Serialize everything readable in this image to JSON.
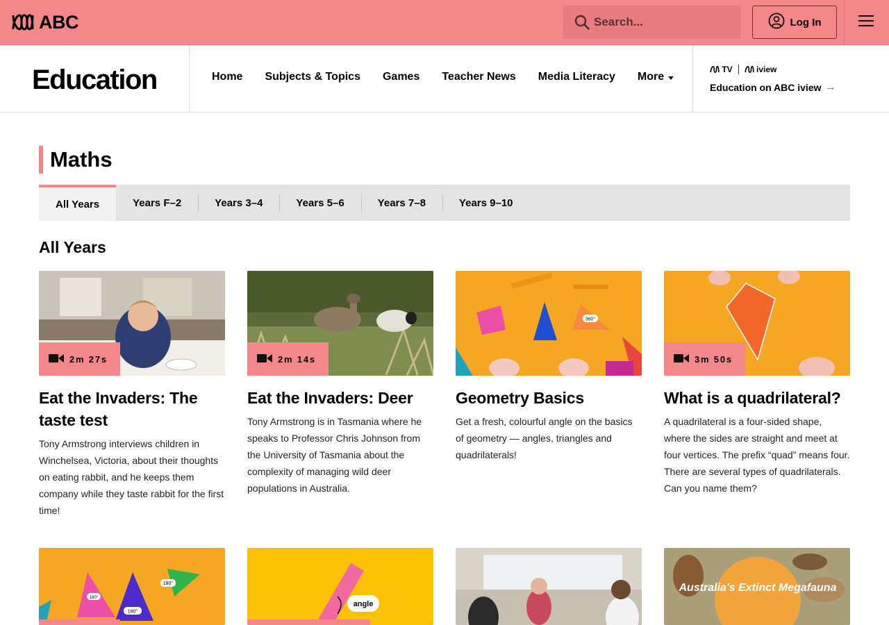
{
  "header": {
    "logo_text": "ABC",
    "search_placeholder": "Search...",
    "login_label": "Log In"
  },
  "nav": {
    "brand": "Education",
    "links": [
      "Home",
      "Subjects & Topics",
      "Games",
      "Teacher News",
      "Media Literacy"
    ],
    "more_label": "More",
    "iview_tv": "TV",
    "iview_brand": "iview",
    "iview_link": "Education on ABC iview",
    "iview_arrow": "→"
  },
  "page": {
    "heading": "Maths",
    "section_title": "All Years",
    "tabs": [
      "All Years",
      "Years F–2",
      "Years 3–4",
      "Years 5–6",
      "Years 7–8",
      "Years 9–10"
    ],
    "active_tab": "All Years"
  },
  "cards": [
    {
      "title": "Eat the Invaders: The taste test",
      "duration": "2m 27s",
      "description": "Tony Armstrong interviews children in Winchelsea, Victoria, about their thoughts on eating rabbit, and he keeps them company while they taste rabbit for the first time!"
    },
    {
      "title": "Eat the Invaders: Deer",
      "duration": "2m 14s",
      "description": "Tony Armstrong is in Tasmania where he speaks to Professor Chris Johnson from the University of Tasmania about the complexity of managing wild deer populations in Australia."
    },
    {
      "title": "Geometry Basics",
      "duration": "",
      "description": "Get a fresh, colourful angle on the basics of geometry — angles, triangles and quadrilaterals!",
      "thumb_text": "360°"
    },
    {
      "title": "What is a quadrilateral?",
      "duration": "3m 50s",
      "description": "A quadrilateral is a four-sided shape, where the sides are straight and meet at four vertices. The prefix “quad” means four. There are several types of quadrilaterals. Can you name them?"
    }
  ],
  "bottom_cards": [
    {
      "thumb_text": [
        "180°",
        "180°",
        "180°"
      ]
    },
    {
      "thumb_text": "angle"
    },
    {
      "thumb_text": ""
    },
    {
      "thumb_text": "Australia's Extinct Megafauna"
    }
  ],
  "colors": {
    "accent": "#F4878A",
    "search_bg": "#E87C80",
    "tabs_bg": "#E4E4E4"
  }
}
